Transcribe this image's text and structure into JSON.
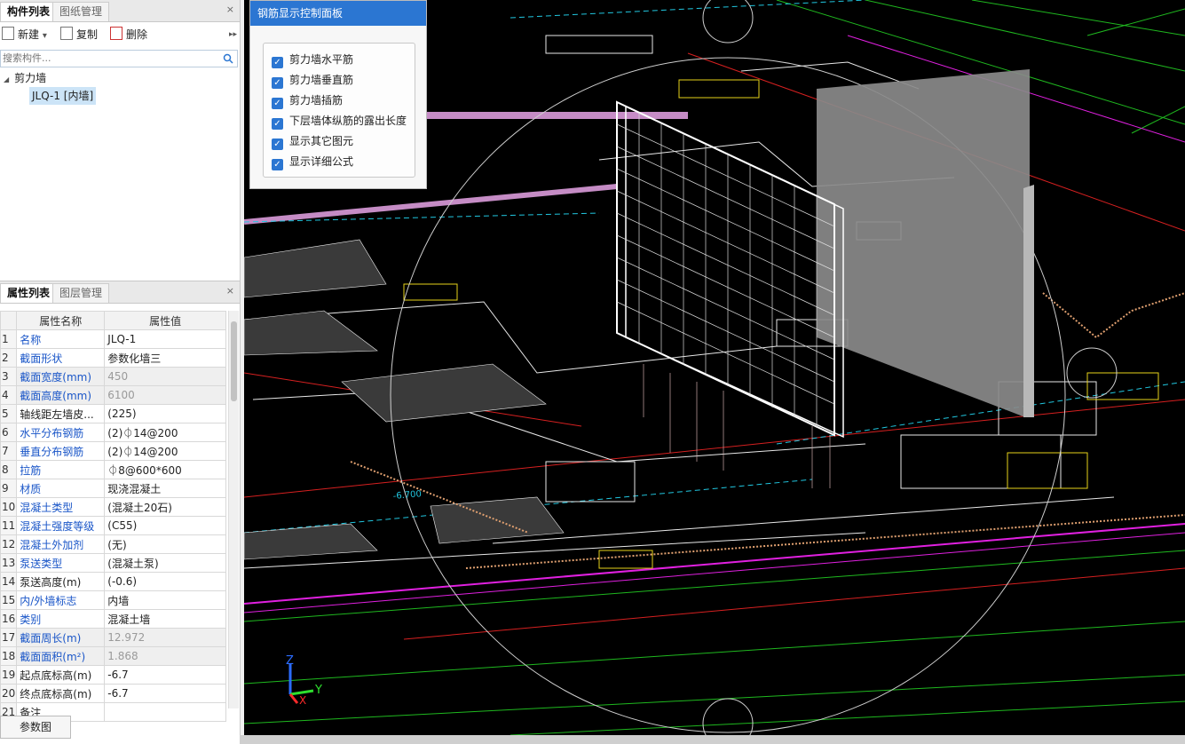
{
  "component_panel": {
    "tabs": [
      "构件列表",
      "图纸管理"
    ],
    "close": "×",
    "toolbar": {
      "new": "新建",
      "new_arrow": "▾",
      "copy": "复制",
      "delete": "删除",
      "more": "▸▸"
    },
    "search_placeholder": "搜索构件...",
    "tree": {
      "category": "剪力墙",
      "item": "JLQ-1 [内墙]",
      "expand": "◢"
    }
  },
  "property_panel": {
    "tabs": [
      "属性列表",
      "图层管理"
    ],
    "close": "×",
    "headers": [
      "属性名称",
      "属性值"
    ],
    "rows": [
      {
        "n": "1",
        "name": "名称",
        "value": "JLQ-1",
        "blue": true
      },
      {
        "n": "2",
        "name": "截面形状",
        "value": "参数化墙三",
        "blue": true
      },
      {
        "n": "3",
        "name": "截面宽度(mm)",
        "value": "450",
        "blue": true,
        "gray": true
      },
      {
        "n": "4",
        "name": "截面高度(mm)",
        "value": "6100",
        "blue": true,
        "gray": true
      },
      {
        "n": "5",
        "name": "轴线距左墙皮...",
        "value": "(225)",
        "blue": false
      },
      {
        "n": "6",
        "name": "水平分布钢筋",
        "value": "(2)⏀14@200",
        "blue": true
      },
      {
        "n": "7",
        "name": "垂直分布钢筋",
        "value": "(2)⏀14@200",
        "blue": true
      },
      {
        "n": "8",
        "name": "拉筋",
        "value": "⏀8@600*600",
        "blue": true
      },
      {
        "n": "9",
        "name": "材质",
        "value": "现浇混凝土",
        "blue": true
      },
      {
        "n": "10",
        "name": "混凝土类型",
        "value": "(混凝土20石)",
        "blue": true
      },
      {
        "n": "11",
        "name": "混凝土强度等级",
        "value": "(C55)",
        "blue": true
      },
      {
        "n": "12",
        "name": "混凝土外加剂",
        "value": "(无)",
        "blue": true
      },
      {
        "n": "13",
        "name": "泵送类型",
        "value": "(混凝土泵)",
        "blue": true
      },
      {
        "n": "14",
        "name": "泵送高度(m)",
        "value": "(-0.6)",
        "blue": false
      },
      {
        "n": "15",
        "name": "内/外墙标志",
        "value": "内墙",
        "blue": true
      },
      {
        "n": "16",
        "name": "类别",
        "value": "混凝土墙",
        "blue": true
      },
      {
        "n": "17",
        "name": "截面周长(m)",
        "value": "12.972",
        "blue": true,
        "gray": true
      },
      {
        "n": "18",
        "name": "截面面积(m²)",
        "value": "1.868",
        "blue": true,
        "gray": true
      },
      {
        "n": "19",
        "name": "起点底标高(m)",
        "value": "-6.7",
        "blue": false
      },
      {
        "n": "20",
        "name": "终点底标高(m)",
        "value": "-6.7",
        "blue": false
      },
      {
        "n": "21",
        "name": "备注",
        "value": "",
        "blue": false
      }
    ],
    "footer_button": "参数图"
  },
  "rebar_control": {
    "title": "钢筋显示控制面板",
    "check_mark": "✓",
    "options": [
      "剪力墙水平筋",
      "剪力墙垂直筋",
      "剪力墙插筋",
      "下层墙体纵筋的露出长度",
      "显示其它图元",
      "显示详细公式"
    ]
  },
  "viewport": {
    "elevation_label": "-6.700",
    "axis_labels": {
      "z": "Z",
      "y": "Y",
      "x": "X"
    }
  },
  "colors": {
    "accent": "#2b76d2",
    "label_blue": "#1a56c8",
    "viewport_bg": "#000000"
  }
}
